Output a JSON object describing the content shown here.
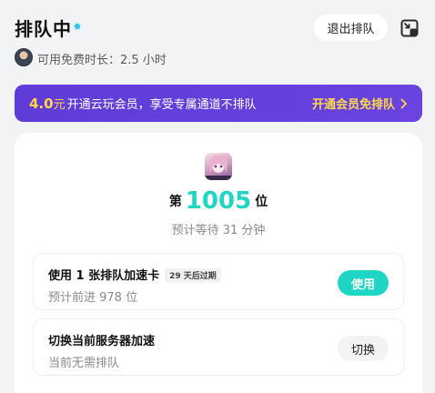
{
  "header": {
    "title": "排队中",
    "exit_label": "退出排队",
    "free_time_text": "可用免费时长：2.5 小时"
  },
  "banner": {
    "price": "4.0",
    "unit": "元",
    "description": "开通云玩会员，享受专属通道不排队",
    "cta": "开通会员免排队"
  },
  "queue": {
    "prefix": "第",
    "position": "1005",
    "suffix": "位",
    "wait_text": "预计等待 31 分钟"
  },
  "options": [
    {
      "title": "使用 1 张排队加速卡",
      "badge": "29 天后过期",
      "subtitle": "预计前进 978 位",
      "button": "使用"
    },
    {
      "title": "切换当前服务器加速",
      "subtitle": "当前无需排队",
      "button": "切换"
    }
  ],
  "colors": {
    "accent": "#1fd6c4",
    "banner": "#5f3bd8",
    "banner_highlight": "#ffd84a"
  },
  "icons": {
    "status": "status-dot-icon",
    "window": "minimize-window-icon",
    "avatar": "user-avatar",
    "chevron": "chevron-right-icon",
    "game": "game-cover-icon"
  }
}
